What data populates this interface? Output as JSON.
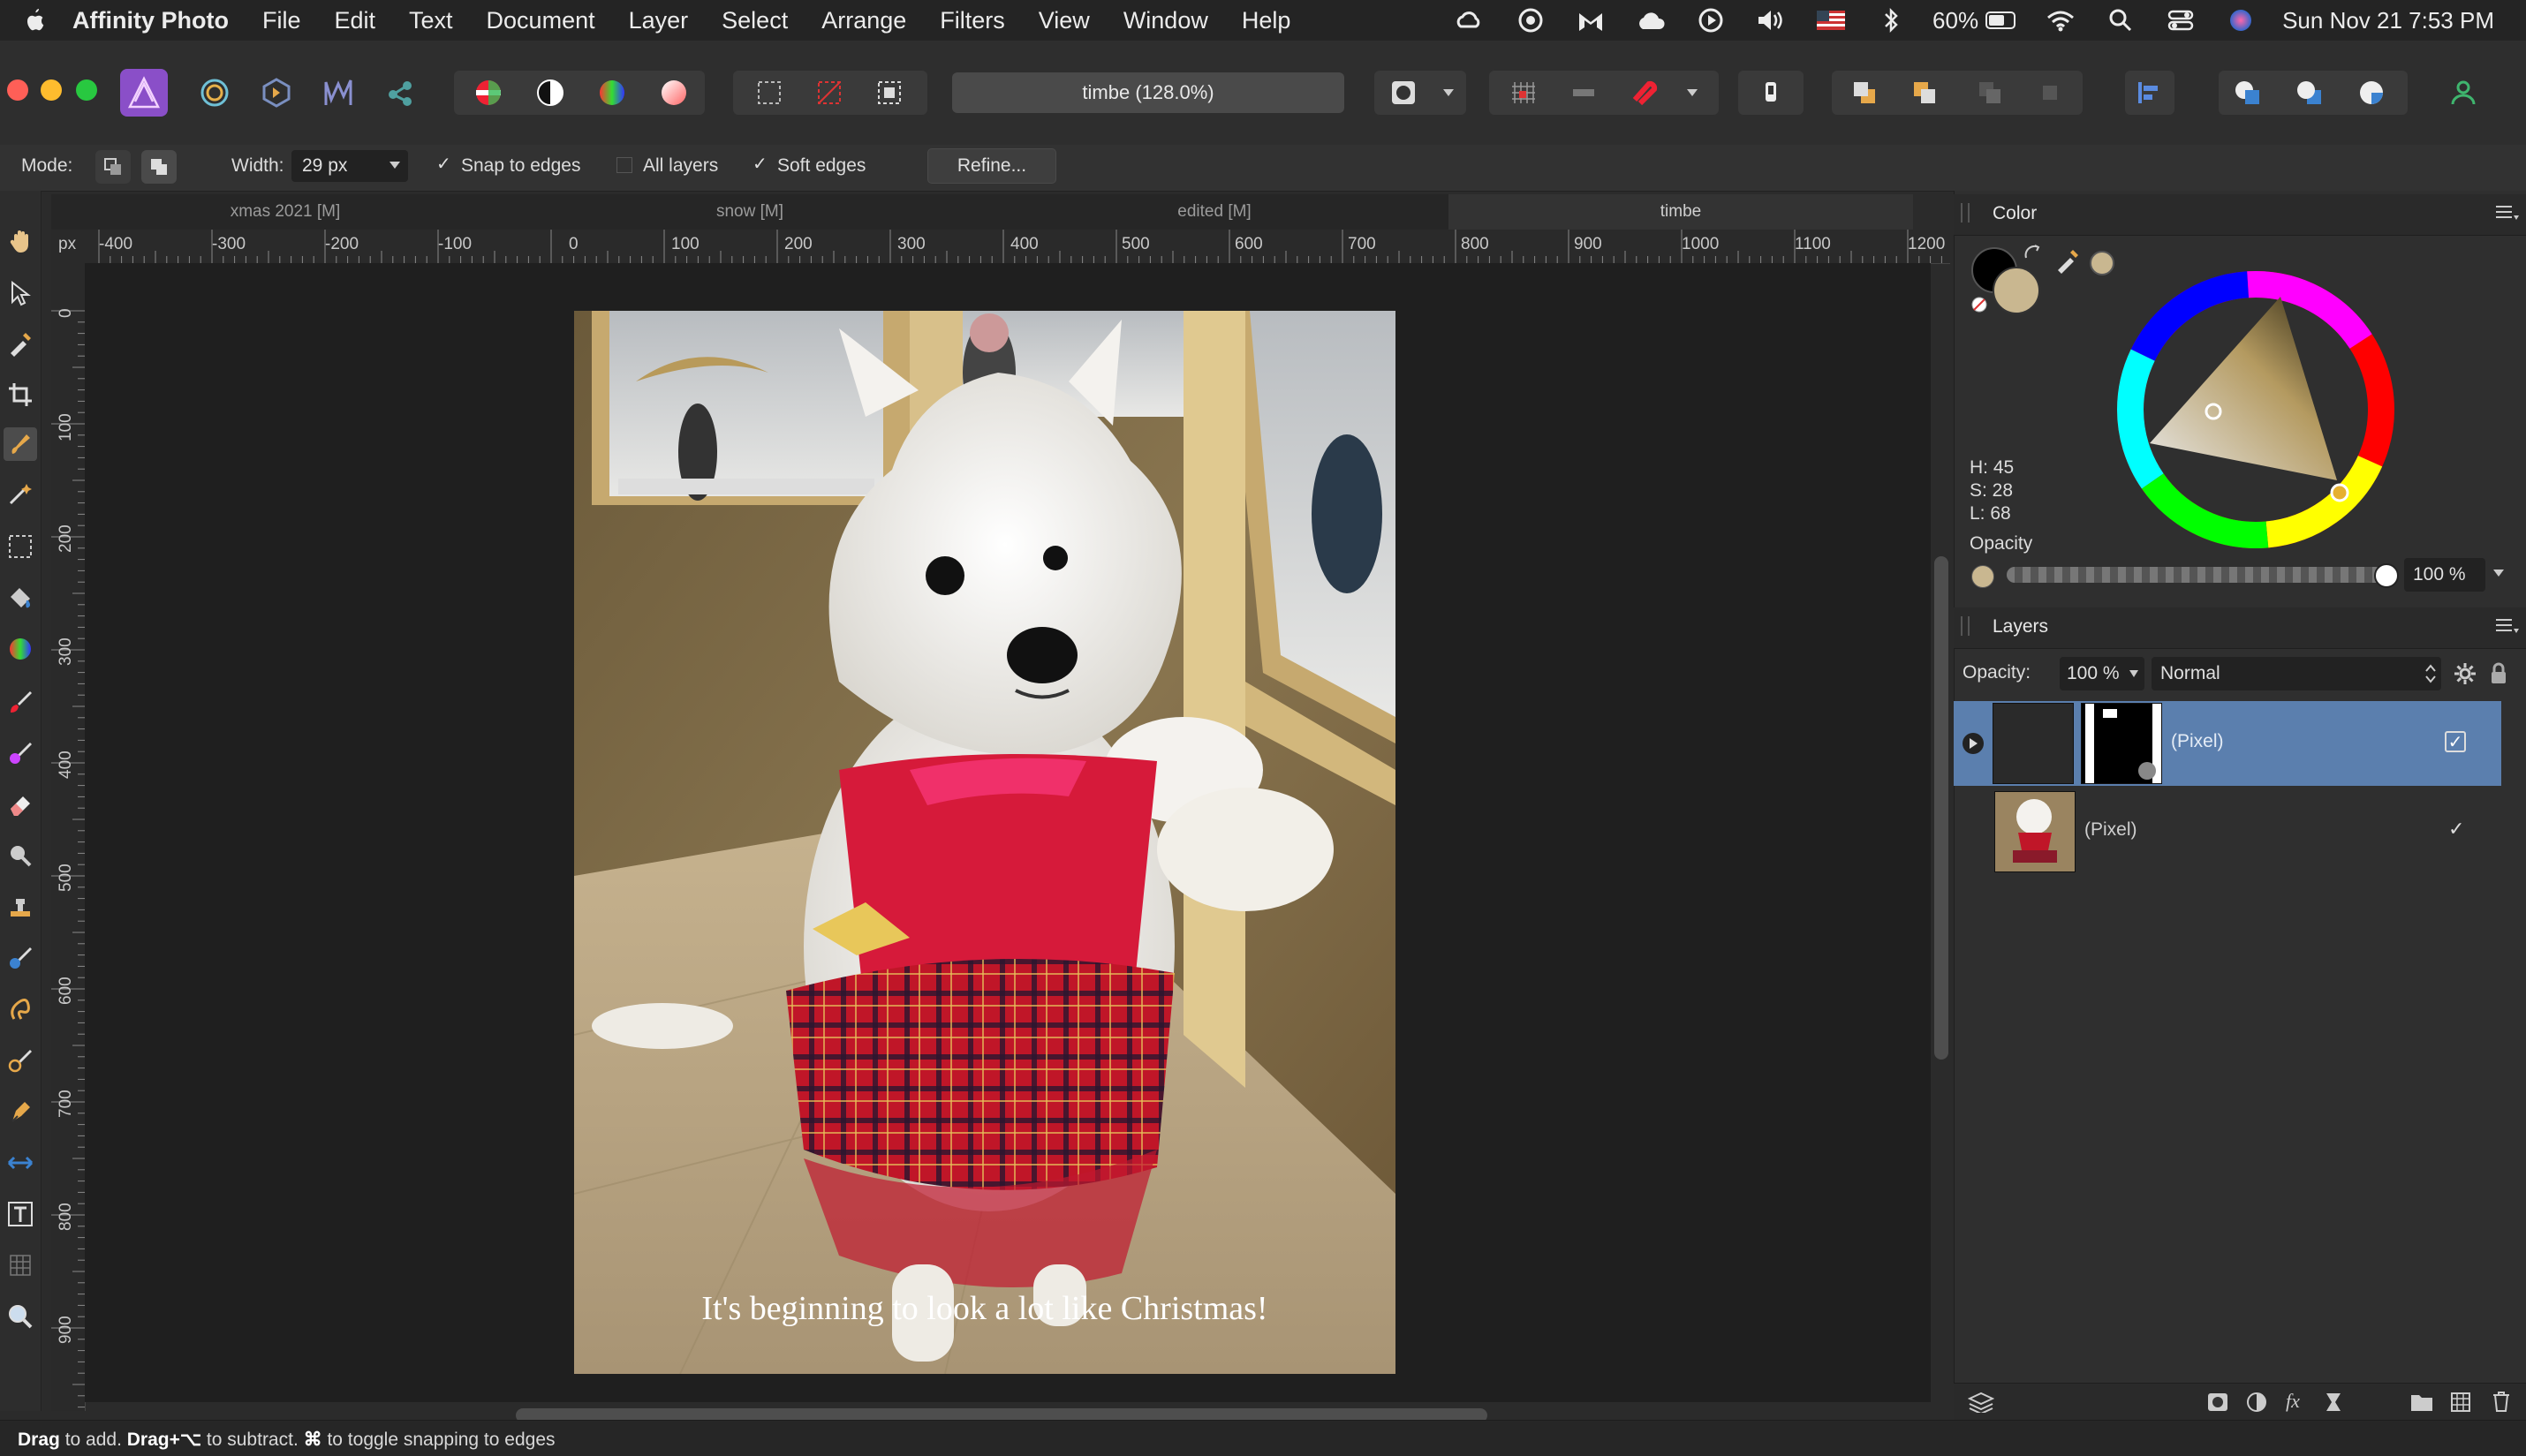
{
  "menubar": {
    "app_name": "Affinity Photo",
    "items": [
      "File",
      "Edit",
      "Text",
      "Document",
      "Layer",
      "Select",
      "Arrange",
      "Filters",
      "View",
      "Window",
      "Help"
    ],
    "battery": "60%",
    "clock": "Sun Nov 21  7:53 PM"
  },
  "toolbar": {
    "doc_title": "timbe (128.0%)"
  },
  "context": {
    "mode_label": "Mode:",
    "width_label": "Width:",
    "width_value": "29 px",
    "snap_label": "Snap to edges",
    "all_layers_label": "All layers",
    "soft_edges_label": "Soft edges",
    "refine_label": "Refine..."
  },
  "tabs": [
    {
      "label": "xmas 2021 [M]",
      "active": false
    },
    {
      "label": "snow [M]",
      "active": false
    },
    {
      "label": "edited [M]",
      "active": false
    },
    {
      "label": "timbe",
      "active": true
    }
  ],
  "rulers": {
    "unit": "px",
    "top_labels": [
      "-400",
      "-300",
      "-200",
      "-100",
      "0",
      "100",
      "200",
      "300",
      "400",
      "500",
      "600",
      "700",
      "800",
      "900",
      "1000",
      "1100",
      "1200"
    ],
    "left_labels": [
      "0",
      "100",
      "200",
      "300",
      "400",
      "500",
      "600",
      "700",
      "800",
      "900"
    ]
  },
  "canvas": {
    "caption": "It's beginning to look a lot like Christmas!"
  },
  "color_panel": {
    "title": "Color",
    "h": "H: 45",
    "s": "S: 28",
    "l": "L: 68",
    "opacity_label": "Opacity",
    "opacity_value": "100 %",
    "swatch_color": "#c9b790"
  },
  "layers_panel": {
    "title": "Layers",
    "opacity_label": "Opacity:",
    "opacity_value": "100 %",
    "blend_mode": "Normal",
    "layers": [
      {
        "name": "(Pixel)",
        "selected": true,
        "visible": true
      },
      {
        "name": "(Pixel)",
        "selected": false,
        "visible": true
      }
    ]
  },
  "statusbar": {
    "drag": "Drag",
    "t1": " to add. ",
    "drag2": "Drag+⌥",
    "t2": " to subtract. ",
    "cmd": "⌘",
    "t3": " to toggle snapping to edges"
  },
  "colors": {
    "accent_selection": "#5b7fae",
    "app_icon": "#8a4fc8"
  }
}
